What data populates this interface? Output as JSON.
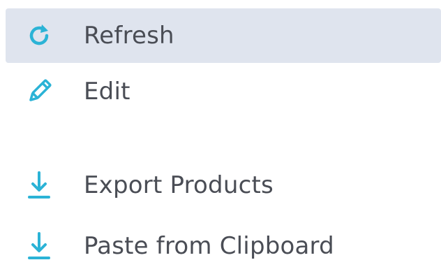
{
  "theme": {
    "accent": "#2bb3d6",
    "active_background": "#dfe4ee",
    "text": "#4a4d55"
  },
  "menu": {
    "items": [
      {
        "label": "Refresh",
        "icon": "refresh-icon",
        "active": true
      },
      {
        "label": "Edit",
        "icon": "pencil-icon",
        "active": false
      },
      {
        "label": "Export Products",
        "icon": "download-icon",
        "active": false
      },
      {
        "label": "Paste from Clipboard",
        "icon": "download-icon",
        "active": false
      }
    ]
  }
}
